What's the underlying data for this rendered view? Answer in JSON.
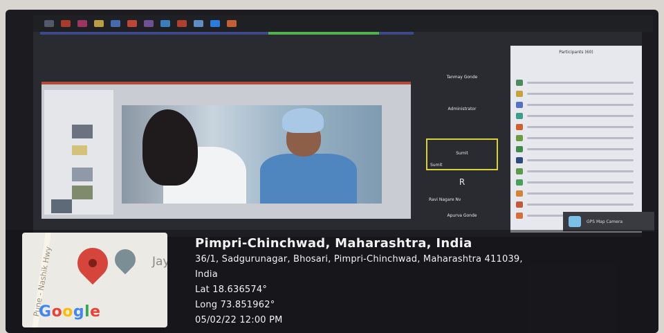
{
  "gps_overlay": {
    "location_title": "Pimpri-Chinchwad, Maharashtra, India",
    "address_line1": "36/1, Sadgurunagar, Bhosari, Pimpri-Chinchwad, Maharashtra 411039,",
    "address_line2": "India",
    "latitude": "Lat 18.636574°",
    "longitude": "Long 73.851962°",
    "timestamp": "05/02/22 12:00 PM",
    "map": {
      "road_label": "Pune - Nashik Hwy",
      "place_label": "Jay",
      "provider": "Google"
    },
    "badge_label": "GPS Map Camera"
  },
  "meeting": {
    "participants_title": "Participants (60)",
    "video_tiles": [
      {
        "center": "Tanmay Gonde",
        "name": "Tanmay Gonde"
      },
      {
        "center": "Administrator",
        "name": "Administrator"
      },
      {
        "center": "Sumit",
        "name": "Sumit"
      },
      {
        "center": "R",
        "name": "Ravi Nagare Nv"
      },
      {
        "center": "Apurva Gonde",
        "name": "Apurva Gonde"
      }
    ]
  },
  "colors": {
    "pin": "#d6453b",
    "active_speaker_border": "#d9d23a",
    "google_blue": "#4285f4",
    "google_red": "#ea4335",
    "google_yellow": "#fbbc05",
    "google_green": "#34a853"
  }
}
